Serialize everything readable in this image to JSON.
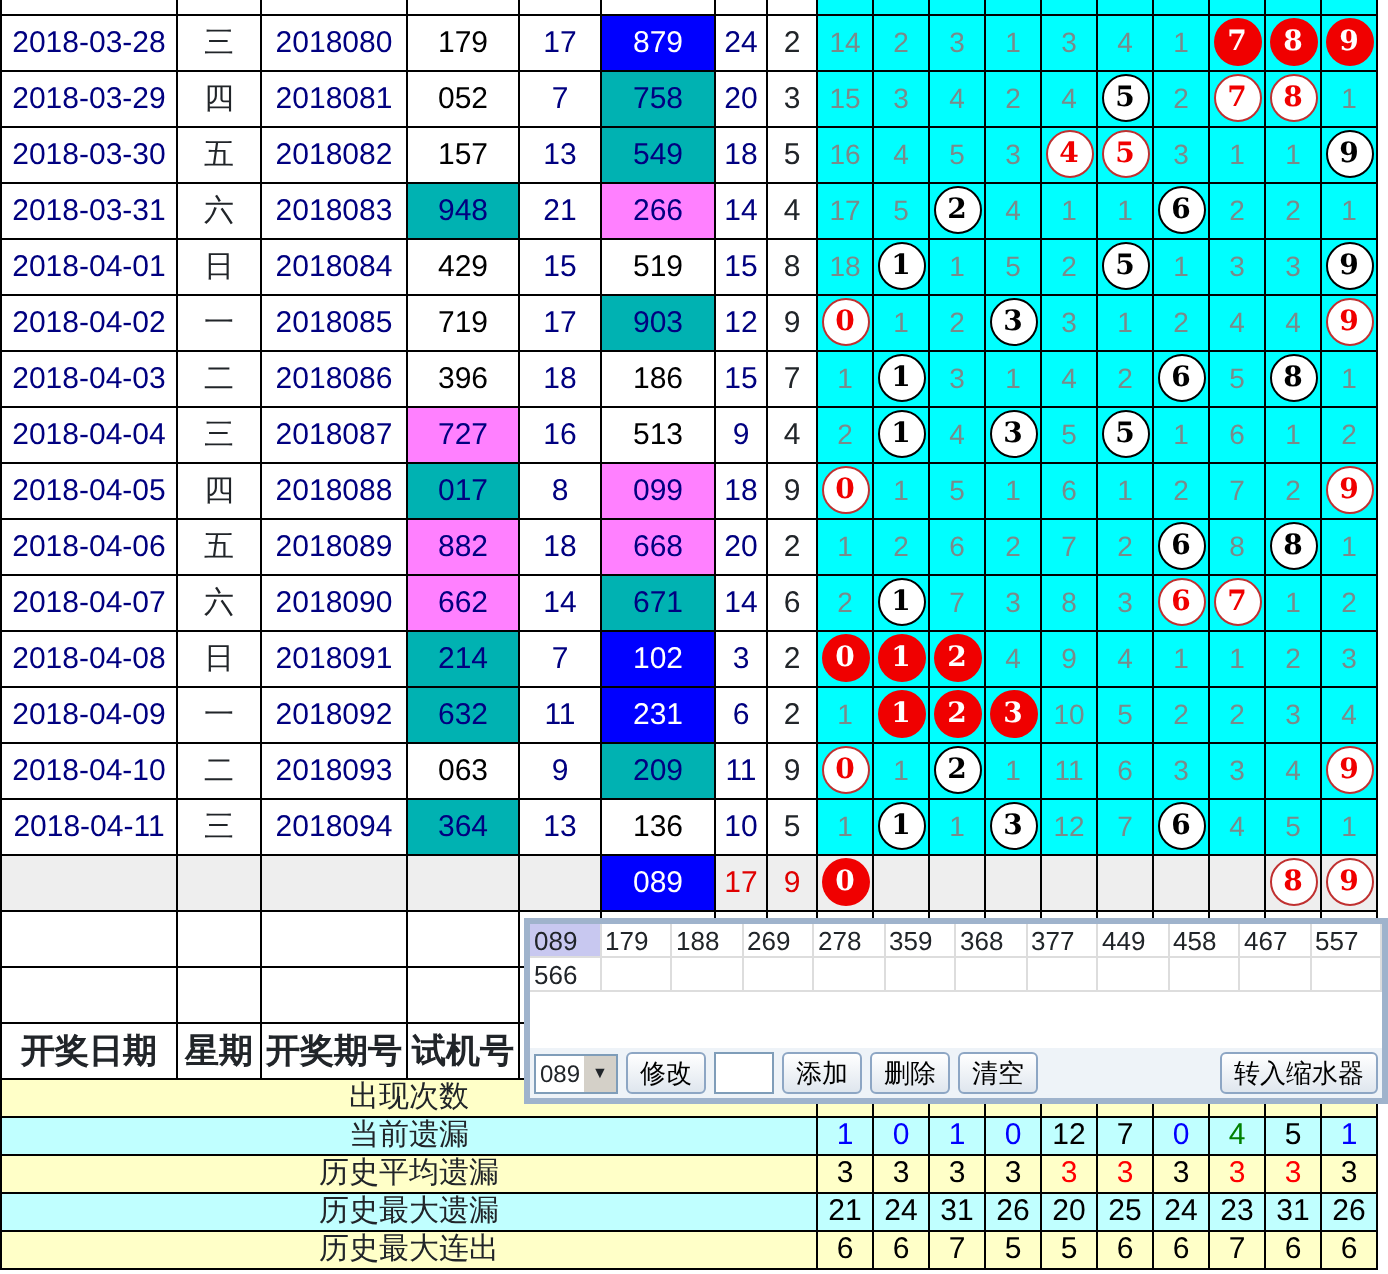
{
  "rows": [
    {
      "date": "2018-03-28",
      "weekday": "三",
      "issue": "2018080",
      "test": {
        "text": "179",
        "color": "#ffffff"
      },
      "test_sum": "17",
      "draw": {
        "text": "879",
        "color": "#0000ff"
      },
      "draw_sum": "24",
      "span": "2",
      "digits": [
        {
          "kind": "count",
          "text": "14"
        },
        {
          "kind": "count",
          "text": "2"
        },
        {
          "kind": "count",
          "text": "3"
        },
        {
          "kind": "count",
          "text": "1"
        },
        {
          "kind": "count",
          "text": "3"
        },
        {
          "kind": "count",
          "text": "4"
        },
        {
          "kind": "count",
          "text": "1"
        },
        {
          "kind": "filled",
          "text": "7"
        },
        {
          "kind": "filled",
          "text": "8"
        },
        {
          "kind": "filled",
          "text": "9"
        }
      ]
    },
    {
      "date": "2018-03-29",
      "weekday": "四",
      "issue": "2018081",
      "test": {
        "text": "052",
        "color": "#ffffff"
      },
      "test_sum": "7",
      "draw": {
        "text": "758",
        "color": "#00b2b2"
      },
      "draw_sum": "20",
      "span": "3",
      "digits": [
        {
          "kind": "count",
          "text": "15"
        },
        {
          "kind": "count",
          "text": "3"
        },
        {
          "kind": "count",
          "text": "4"
        },
        {
          "kind": "count",
          "text": "2"
        },
        {
          "kind": "count",
          "text": "4"
        },
        {
          "kind": "ball",
          "text": "5"
        },
        {
          "kind": "count",
          "text": "2"
        },
        {
          "kind": "outlined",
          "text": "7"
        },
        {
          "kind": "outlined",
          "text": "8"
        },
        {
          "kind": "count",
          "text": "1"
        }
      ]
    },
    {
      "date": "2018-03-30",
      "weekday": "五",
      "issue": "2018082",
      "test": {
        "text": "157",
        "color": "#ffffff"
      },
      "test_sum": "13",
      "draw": {
        "text": "549",
        "color": "#00b2b2"
      },
      "draw_sum": "18",
      "span": "5",
      "digits": [
        {
          "kind": "count",
          "text": "16"
        },
        {
          "kind": "count",
          "text": "4"
        },
        {
          "kind": "count",
          "text": "5"
        },
        {
          "kind": "count",
          "text": "3"
        },
        {
          "kind": "outlined",
          "text": "4"
        },
        {
          "kind": "outlined",
          "text": "5"
        },
        {
          "kind": "count",
          "text": "3"
        },
        {
          "kind": "count",
          "text": "1"
        },
        {
          "kind": "count",
          "text": "1"
        },
        {
          "kind": "ball",
          "text": "9"
        }
      ]
    },
    {
      "date": "2018-03-31",
      "weekday": "六",
      "issue": "2018083",
      "test": {
        "text": "948",
        "color": "#00b2b2"
      },
      "test_sum": "21",
      "draw": {
        "text": "266",
        "color": "#ff80ff"
      },
      "draw_sum": "14",
      "span": "4",
      "digits": [
        {
          "kind": "count",
          "text": "17"
        },
        {
          "kind": "count",
          "text": "5"
        },
        {
          "kind": "ball",
          "text": "2"
        },
        {
          "kind": "count",
          "text": "4"
        },
        {
          "kind": "count",
          "text": "1"
        },
        {
          "kind": "count",
          "text": "1"
        },
        {
          "kind": "ball",
          "text": "6"
        },
        {
          "kind": "count",
          "text": "2"
        },
        {
          "kind": "count",
          "text": "2"
        },
        {
          "kind": "count",
          "text": "1"
        }
      ]
    },
    {
      "date": "2018-04-01",
      "weekday": "日",
      "issue": "2018084",
      "test": {
        "text": "429",
        "color": "#ffffff"
      },
      "test_sum": "15",
      "draw": {
        "text": "519",
        "color": "#ffffff"
      },
      "draw_sum": "15",
      "span": "8",
      "digits": [
        {
          "kind": "count",
          "text": "18"
        },
        {
          "kind": "ball",
          "text": "1"
        },
        {
          "kind": "count",
          "text": "1"
        },
        {
          "kind": "count",
          "text": "5"
        },
        {
          "kind": "count",
          "text": "2"
        },
        {
          "kind": "ball",
          "text": "5"
        },
        {
          "kind": "count",
          "text": "1"
        },
        {
          "kind": "count",
          "text": "3"
        },
        {
          "kind": "count",
          "text": "3"
        },
        {
          "kind": "ball",
          "text": "9"
        }
      ]
    },
    {
      "date": "2018-04-02",
      "weekday": "一",
      "issue": "2018085",
      "test": {
        "text": "719",
        "color": "#ffffff"
      },
      "test_sum": "17",
      "draw": {
        "text": "903",
        "color": "#00b2b2"
      },
      "draw_sum": "12",
      "span": "9",
      "digits": [
        {
          "kind": "outlined",
          "text": "0"
        },
        {
          "kind": "count",
          "text": "1"
        },
        {
          "kind": "count",
          "text": "2"
        },
        {
          "kind": "ball",
          "text": "3"
        },
        {
          "kind": "count",
          "text": "3"
        },
        {
          "kind": "count",
          "text": "1"
        },
        {
          "kind": "count",
          "text": "2"
        },
        {
          "kind": "count",
          "text": "4"
        },
        {
          "kind": "count",
          "text": "4"
        },
        {
          "kind": "outlined",
          "text": "9"
        }
      ]
    },
    {
      "date": "2018-04-03",
      "weekday": "二",
      "issue": "2018086",
      "test": {
        "text": "396",
        "color": "#ffffff"
      },
      "test_sum": "18",
      "draw": {
        "text": "186",
        "color": "#ffffff"
      },
      "draw_sum": "15",
      "span": "7",
      "digits": [
        {
          "kind": "count",
          "text": "1"
        },
        {
          "kind": "ball",
          "text": "1"
        },
        {
          "kind": "count",
          "text": "3"
        },
        {
          "kind": "count",
          "text": "1"
        },
        {
          "kind": "count",
          "text": "4"
        },
        {
          "kind": "count",
          "text": "2"
        },
        {
          "kind": "ball",
          "text": "6"
        },
        {
          "kind": "count",
          "text": "5"
        },
        {
          "kind": "ball",
          "text": "8"
        },
        {
          "kind": "count",
          "text": "1"
        }
      ]
    },
    {
      "date": "2018-04-04",
      "weekday": "三",
      "issue": "2018087",
      "test": {
        "text": "727",
        "color": "#ff80ff"
      },
      "test_sum": "16",
      "draw": {
        "text": "513",
        "color": "#ffffff"
      },
      "draw_sum": "9",
      "span": "4",
      "digits": [
        {
          "kind": "count",
          "text": "2"
        },
        {
          "kind": "ball",
          "text": "1"
        },
        {
          "kind": "count",
          "text": "4"
        },
        {
          "kind": "ball",
          "text": "3"
        },
        {
          "kind": "count",
          "text": "5"
        },
        {
          "kind": "ball",
          "text": "5"
        },
        {
          "kind": "count",
          "text": "1"
        },
        {
          "kind": "count",
          "text": "6"
        },
        {
          "kind": "count",
          "text": "1"
        },
        {
          "kind": "count",
          "text": "2"
        }
      ]
    },
    {
      "date": "2018-04-05",
      "weekday": "四",
      "issue": "2018088",
      "test": {
        "text": "017",
        "color": "#00b2b2"
      },
      "test_sum": "8",
      "draw": {
        "text": "099",
        "color": "#ff80ff"
      },
      "draw_sum": "18",
      "span": "9",
      "digits": [
        {
          "kind": "outlined",
          "text": "0"
        },
        {
          "kind": "count",
          "text": "1"
        },
        {
          "kind": "count",
          "text": "5"
        },
        {
          "kind": "count",
          "text": "1"
        },
        {
          "kind": "count",
          "text": "6"
        },
        {
          "kind": "count",
          "text": "1"
        },
        {
          "kind": "count",
          "text": "2"
        },
        {
          "kind": "count",
          "text": "7"
        },
        {
          "kind": "count",
          "text": "2"
        },
        {
          "kind": "outlined",
          "text": "9"
        }
      ]
    },
    {
      "date": "2018-04-06",
      "weekday": "五",
      "issue": "2018089",
      "test": {
        "text": "882",
        "color": "#ff80ff"
      },
      "test_sum": "18",
      "draw": {
        "text": "668",
        "color": "#ff80ff"
      },
      "draw_sum": "20",
      "span": "2",
      "digits": [
        {
          "kind": "count",
          "text": "1"
        },
        {
          "kind": "count",
          "text": "2"
        },
        {
          "kind": "count",
          "text": "6"
        },
        {
          "kind": "count",
          "text": "2"
        },
        {
          "kind": "count",
          "text": "7"
        },
        {
          "kind": "count",
          "text": "2"
        },
        {
          "kind": "ball",
          "text": "6"
        },
        {
          "kind": "count",
          "text": "8"
        },
        {
          "kind": "ball",
          "text": "8"
        },
        {
          "kind": "count",
          "text": "1"
        }
      ]
    },
    {
      "date": "2018-04-07",
      "weekday": "六",
      "issue": "2018090",
      "test": {
        "text": "662",
        "color": "#ff80ff"
      },
      "test_sum": "14",
      "draw": {
        "text": "671",
        "color": "#00b2b2"
      },
      "draw_sum": "14",
      "span": "6",
      "digits": [
        {
          "kind": "count",
          "text": "2"
        },
        {
          "kind": "ball",
          "text": "1"
        },
        {
          "kind": "count",
          "text": "7"
        },
        {
          "kind": "count",
          "text": "3"
        },
        {
          "kind": "count",
          "text": "8"
        },
        {
          "kind": "count",
          "text": "3"
        },
        {
          "kind": "outlined",
          "text": "6"
        },
        {
          "kind": "outlined",
          "text": "7"
        },
        {
          "kind": "count",
          "text": "1"
        },
        {
          "kind": "count",
          "text": "2"
        }
      ]
    },
    {
      "date": "2018-04-08",
      "weekday": "日",
      "issue": "2018091",
      "test": {
        "text": "214",
        "color": "#00b2b2"
      },
      "test_sum": "7",
      "draw": {
        "text": "102",
        "color": "#0000ff"
      },
      "draw_sum": "3",
      "span": "2",
      "digits": [
        {
          "kind": "filled",
          "text": "0"
        },
        {
          "kind": "filled",
          "text": "1"
        },
        {
          "kind": "filled",
          "text": "2"
        },
        {
          "kind": "count",
          "text": "4"
        },
        {
          "kind": "count",
          "text": "9"
        },
        {
          "kind": "count",
          "text": "4"
        },
        {
          "kind": "count",
          "text": "1"
        },
        {
          "kind": "count",
          "text": "1"
        },
        {
          "kind": "count",
          "text": "2"
        },
        {
          "kind": "count",
          "text": "3"
        }
      ]
    },
    {
      "date": "2018-04-09",
      "weekday": "一",
      "issue": "2018092",
      "test": {
        "text": "632",
        "color": "#00b2b2"
      },
      "test_sum": "11",
      "draw": {
        "text": "231",
        "color": "#0000ff"
      },
      "draw_sum": "6",
      "span": "2",
      "digits": [
        {
          "kind": "count",
          "text": "1"
        },
        {
          "kind": "filled",
          "text": "1"
        },
        {
          "kind": "filled",
          "text": "2"
        },
        {
          "kind": "filled",
          "text": "3"
        },
        {
          "kind": "count",
          "text": "10"
        },
        {
          "kind": "count",
          "text": "5"
        },
        {
          "kind": "count",
          "text": "2"
        },
        {
          "kind": "count",
          "text": "2"
        },
        {
          "kind": "count",
          "text": "3"
        },
        {
          "kind": "count",
          "text": "4"
        }
      ]
    },
    {
      "date": "2018-04-10",
      "weekday": "二",
      "issue": "2018093",
      "test": {
        "text": "063",
        "color": "#ffffff"
      },
      "test_sum": "9",
      "draw": {
        "text": "209",
        "color": "#00b2b2"
      },
      "draw_sum": "11",
      "span": "9",
      "digits": [
        {
          "kind": "outlined",
          "text": "0"
        },
        {
          "kind": "count",
          "text": "1"
        },
        {
          "kind": "ball",
          "text": "2"
        },
        {
          "kind": "count",
          "text": "1"
        },
        {
          "kind": "count",
          "text": "11"
        },
        {
          "kind": "count",
          "text": "6"
        },
        {
          "kind": "count",
          "text": "3"
        },
        {
          "kind": "count",
          "text": "3"
        },
        {
          "kind": "count",
          "text": "4"
        },
        {
          "kind": "outlined",
          "text": "9"
        }
      ]
    },
    {
      "date": "2018-04-11",
      "weekday": "三",
      "issue": "2018094",
      "test": {
        "text": "364",
        "color": "#00b2b2"
      },
      "test_sum": "13",
      "draw": {
        "text": "136",
        "color": "#ffffff"
      },
      "draw_sum": "10",
      "span": "5",
      "digits": [
        {
          "kind": "count",
          "text": "1"
        },
        {
          "kind": "ball",
          "text": "1"
        },
        {
          "kind": "count",
          "text": "1"
        },
        {
          "kind": "ball",
          "text": "3"
        },
        {
          "kind": "count",
          "text": "12"
        },
        {
          "kind": "count",
          "text": "7"
        },
        {
          "kind": "ball",
          "text": "6"
        },
        {
          "kind": "count",
          "text": "4"
        },
        {
          "kind": "count",
          "text": "5"
        },
        {
          "kind": "count",
          "text": "1"
        }
      ]
    }
  ],
  "forecast": {
    "draw": {
      "text": "089",
      "color": "#0000ff"
    },
    "draw_sum": "17",
    "span": "9",
    "digits": [
      {
        "kind": "filled",
        "text": "0"
      },
      {
        "kind": "blank"
      },
      {
        "kind": "blank"
      },
      {
        "kind": "blank"
      },
      {
        "kind": "blank"
      },
      {
        "kind": "blank"
      },
      {
        "kind": "blank"
      },
      {
        "kind": "blank"
      },
      {
        "kind": "outlined",
        "text": "8"
      },
      {
        "kind": "outlined",
        "text": "9"
      }
    ]
  },
  "header": [
    "开奖日期",
    "星期",
    "开奖期号",
    "试机号"
  ],
  "stats": [
    {
      "label": "出现次数",
      "color": "#ffffc8"
    },
    {
      "label": "当前遗漏",
      "color": "#c0ffff",
      "values": [
        {
          "text": "1",
          "color": "#0000ff"
        },
        {
          "text": "0",
          "color": "#0000ff"
        },
        {
          "text": "1",
          "color": "#0000ff"
        },
        {
          "text": "0",
          "color": "#0000ff"
        },
        {
          "text": "12",
          "color": "#000000"
        },
        {
          "text": "7",
          "color": "#000000"
        },
        {
          "text": "0",
          "color": "#0000ff"
        },
        {
          "text": "4",
          "color": "#008000"
        },
        {
          "text": "5",
          "color": "#000000"
        },
        {
          "text": "1",
          "color": "#0000ff"
        }
      ]
    },
    {
      "label": "历史平均遗漏",
      "color": "#ffffc8",
      "values": [
        {
          "text": "3",
          "color": "#000000"
        },
        {
          "text": "3",
          "color": "#000000"
        },
        {
          "text": "3",
          "color": "#000000"
        },
        {
          "text": "3",
          "color": "#000000"
        },
        {
          "text": "3",
          "color": "#ff0000"
        },
        {
          "text": "3",
          "color": "#ff0000"
        },
        {
          "text": "3",
          "color": "#000000"
        },
        {
          "text": "3",
          "color": "#ff0000"
        },
        {
          "text": "3",
          "color": "#ff0000"
        },
        {
          "text": "3",
          "color": "#000000"
        }
      ]
    },
    {
      "label": "历史最大遗漏",
      "color": "#c0ffff",
      "values": [
        {
          "text": "21",
          "color": "#000000"
        },
        {
          "text": "24",
          "color": "#000000"
        },
        {
          "text": "31",
          "color": "#000000"
        },
        {
          "text": "26",
          "color": "#000000"
        },
        {
          "text": "20",
          "color": "#000000"
        },
        {
          "text": "25",
          "color": "#000000"
        },
        {
          "text": "24",
          "color": "#000000"
        },
        {
          "text": "23",
          "color": "#000000"
        },
        {
          "text": "31",
          "color": "#000000"
        },
        {
          "text": "26",
          "color": "#000000"
        }
      ]
    },
    {
      "label": "历史最大连出",
      "color": "#ffffc8",
      "values": [
        {
          "text": "6",
          "color": "#000000"
        },
        {
          "text": "6",
          "color": "#000000"
        },
        {
          "text": "7",
          "color": "#000000"
        },
        {
          "text": "5",
          "color": "#000000"
        },
        {
          "text": "5",
          "color": "#000000"
        },
        {
          "text": "6",
          "color": "#000000"
        },
        {
          "text": "6",
          "color": "#000000"
        },
        {
          "text": "7",
          "color": "#000000"
        },
        {
          "text": "6",
          "color": "#000000"
        },
        {
          "text": "6",
          "color": "#000000"
        }
      ]
    }
  ],
  "popup": {
    "numbers": [
      {
        "text": "089",
        "selected": true
      },
      {
        "text": "179",
        "selected": false
      },
      {
        "text": "188",
        "selected": false
      },
      {
        "text": "269",
        "selected": false
      },
      {
        "text": "278",
        "selected": false
      },
      {
        "text": "359",
        "selected": false
      },
      {
        "text": "368",
        "selected": false
      },
      {
        "text": "377",
        "selected": false
      },
      {
        "text": "449",
        "selected": false
      },
      {
        "text": "458",
        "selected": false
      },
      {
        "text": "467",
        "selected": false
      },
      {
        "text": "557",
        "selected": false
      },
      {
        "text": "566",
        "selected": false
      }
    ],
    "dropdown": "089",
    "dropdown_arrow": "▼",
    "buttons": [
      "修改",
      "添加",
      "删除",
      "清空"
    ],
    "transfer_button": "转入缩水器"
  }
}
